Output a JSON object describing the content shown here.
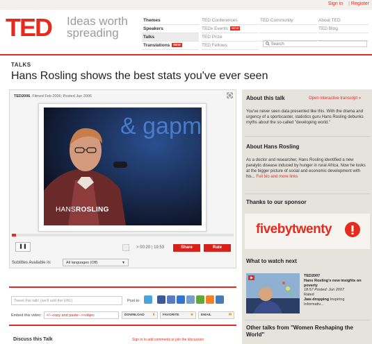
{
  "header": {
    "signin": "Sign in",
    "register": "Register",
    "logo": "TED",
    "tagline": "Ideas worth spreading"
  },
  "nav": {
    "main": [
      {
        "label": "Themes"
      },
      {
        "label": "Speakers"
      },
      {
        "label": "Talks"
      },
      {
        "label": "Translations",
        "badge": "NEW"
      }
    ],
    "col2": [
      {
        "label": "TED Conferences"
      },
      {
        "label": "TEDx Events",
        "badge": "NEW"
      },
      {
        "label": "TED Prize"
      },
      {
        "label": "TED Fellows"
      }
    ],
    "col3": [
      {
        "label": "TED Community"
      }
    ],
    "col4": [
      {
        "label": "About TED"
      },
      {
        "label": "TED Blog"
      }
    ],
    "search_placeholder": "Search"
  },
  "talk": {
    "section": "TALKS",
    "title": "Hans Rosling shows the best stats you've ever seen",
    "event": "TED2006",
    "filmed_label": "Filmed",
    "filmed": "Feb 2006",
    "posted_label": "Posted",
    "posted": "Jun 2006",
    "caption_first": "HANS",
    "caption_last": "ROSLING",
    "slide_text": "& gapm"
  },
  "player": {
    "pause": "❚❚",
    "time_current": "00:20",
    "time_total": "19:53",
    "progress": 0.02,
    "share": "Share",
    "rate": "Rate",
    "subtitles_label": "Subtitles Available in:",
    "subtitles_value": "All languages (Off)"
  },
  "social": {
    "tweet_placeholder": "Tweet this talk! (we'll add the URL)",
    "post_to": "Post to:",
    "icons": [
      {
        "name": "twitter-icon",
        "color": "#4aa3df"
      },
      {
        "name": "facebook-icon",
        "color": "#3b5998"
      },
      {
        "name": "myspace-icon",
        "color": "#5a7bbf"
      },
      {
        "name": "delicious-icon",
        "color": "#3274d1"
      },
      {
        "name": "digg-icon",
        "color": "#7a9cc6"
      },
      {
        "name": "stumbleupon-icon",
        "color": "#5fa83a"
      },
      {
        "name": "rss-icon",
        "color": "#f58220"
      },
      {
        "name": "email-icon",
        "color": "#4a7bb7"
      }
    ],
    "embed_label": "Embed this video:",
    "embed_value": "<!--copy and paste--><objec",
    "download": "DOWNLOAD",
    "favorite": "FAVORITE",
    "email": "EMAIL"
  },
  "discuss": {
    "title": "Discuss this Talk",
    "links": "Sign in to add comments or join the discussion"
  },
  "sidebar": {
    "about_title": "About this talk",
    "transcript_link": "Open interactive transcript »",
    "about_text": "You've never seen data presented like this. With the drama and urgency of a sportscaster, statistics guru Hans Rosling debunks myths about the so-called \"developing world.\"",
    "speaker_title": "About Hans Rosling",
    "speaker_text": "As a doctor and researcher, Hans Rosling identified a new paralytic disease induced by hunger in rural Africa. Now he looks at the bigger picture of social and economic development with his...",
    "speaker_link": "Full bio and more links",
    "sponsor_title": "Thanks to our sponsor",
    "sponsor_name": "fivebytwenty",
    "next_title": "What to watch next",
    "next_event": "TED2007",
    "next_title_text": "Hans Rosling's new insights on poverty",
    "next_meta": "18:57 Posted: Jun 2007",
    "next_rated": "Rated",
    "next_rating": "Jaw-dropping",
    "next_rating2": "Inspiring",
    "next_rating3": "Informativ...",
    "other_title": "Other talks from \"Women Reshaping the World\""
  }
}
